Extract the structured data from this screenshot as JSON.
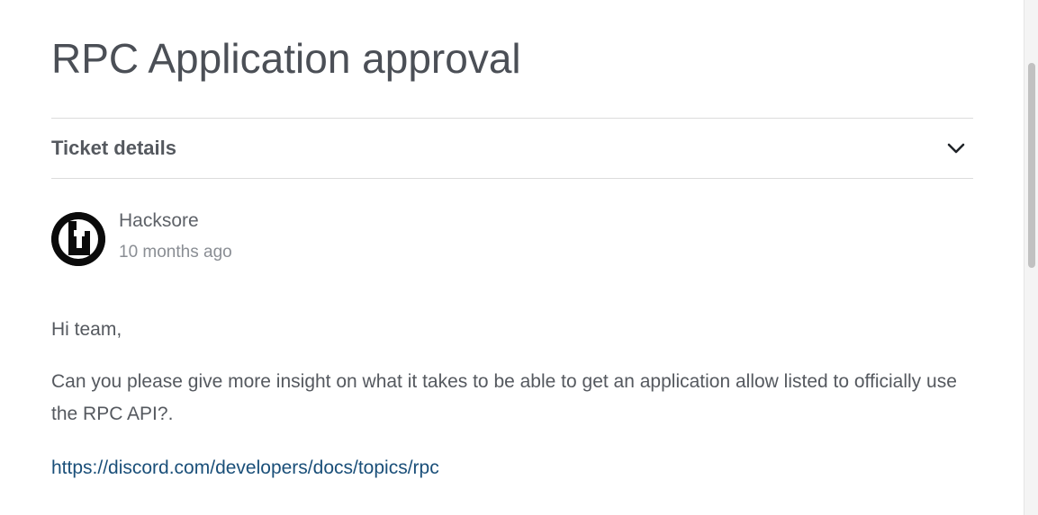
{
  "ticket": {
    "title": "RPC Application approval",
    "details_label": "Ticket details"
  },
  "post": {
    "author": "Hacksore",
    "time": "10 months ago",
    "paragraphs": [
      "Hi team,",
      "Can you please give more insight on what it takes to be able to get an application allow listed to officially use the RPC API?."
    ],
    "link": "https://discord.com/developers/docs/topics/rpc"
  },
  "icons": {
    "details_toggle": "chevron-down-icon",
    "avatar": "avatar-logo"
  },
  "colors": {
    "title": "#4b4f56",
    "text": "#55595f",
    "muted": "#8a8e94",
    "link": "#1a4f79"
  }
}
